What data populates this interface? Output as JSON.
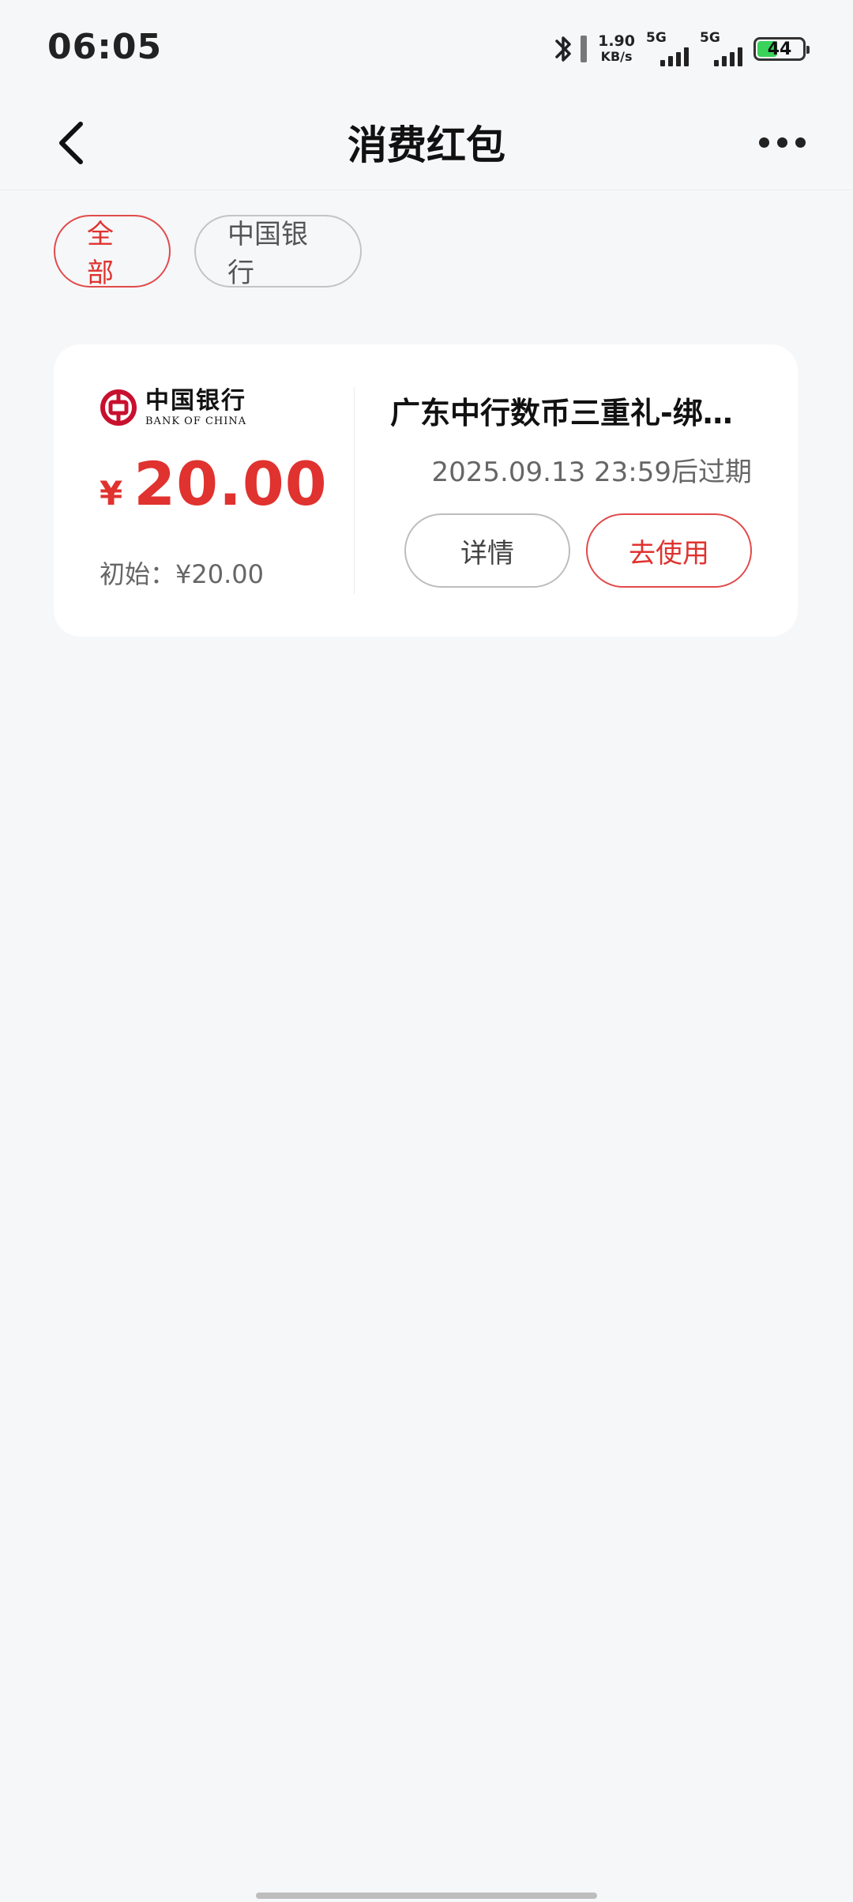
{
  "status_bar": {
    "time": "06:05",
    "net_speed_value": "1.90",
    "net_speed_unit": "KB/s",
    "signal1_label": "5G",
    "signal2_label": "5G",
    "battery_level": "44",
    "battery_color": "#3bd25a"
  },
  "nav": {
    "title": "消费红包",
    "back_icon": "chevron-left-icon",
    "more_icon": "more-horizontal-icon"
  },
  "filters": [
    {
      "label": "全部",
      "active": true
    },
    {
      "label": "中国银行",
      "active": false
    }
  ],
  "coupon": {
    "bank_name_cn": "中国银行",
    "bank_name_en": "BANK OF CHINA",
    "currency_symbol": "¥",
    "amount": "20.00",
    "initial_label": "初始：¥20.00",
    "title": "广东中行数币三重礼-绑…",
    "expire_text": "2025.09.13 23:59后过期",
    "detail_label": "详情",
    "use_label": "去使用"
  },
  "colors": {
    "accent_red": "#e0322f",
    "background": "#f6f7f9",
    "card": "#ffffff"
  }
}
